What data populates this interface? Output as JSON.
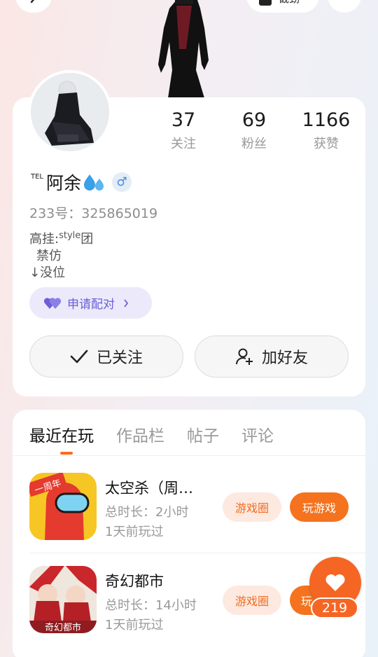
{
  "top": {
    "pill_label": "截劲"
  },
  "profile": {
    "stats": [
      {
        "value": "37",
        "label": "关注"
      },
      {
        "value": "69",
        "label": "粉丝"
      },
      {
        "value": "1166",
        "label": "获赞"
      }
    ],
    "name_prefix": "TEL",
    "name": "阿余",
    "gender_symbol": "♂",
    "uid": "233号：325865019",
    "bio_line1_pre": "高挂:",
    "bio_line1_sup": "style",
    "bio_line1_post": "团",
    "bio_line2": "禁仿",
    "bio_line3": "↓没位",
    "pair_button": "申请配对",
    "follow_button": "已关注",
    "add_friend_button": "加好友"
  },
  "tabs": [
    "最近在玩",
    "作品栏",
    "帖子",
    "评论"
  ],
  "games": [
    {
      "name": "太空杀（周…",
      "duration": "总时长：2小时",
      "last_played": "1天前玩过",
      "circle_button": "游戏圈",
      "play_button": "玩游戏",
      "icon_badge": "一周年"
    },
    {
      "name": "奇幻都市",
      "duration": "总时长：14小时",
      "last_played": "1天前玩过",
      "circle_button": "游戏圈",
      "play_button": "玩",
      "icon_caption": "奇幻都市"
    }
  ],
  "like_count": "219",
  "colors": {
    "accent_orange": "#f5731f",
    "pair_purple": "#6b5fd7"
  }
}
